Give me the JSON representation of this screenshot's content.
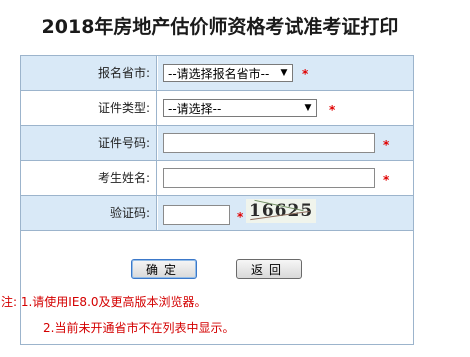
{
  "title": "2018年房地产估价师资格考试准考证打印",
  "form": {
    "province_label": "报名省市:",
    "province_value": "--请选择报名省市--",
    "id_type_label": "证件类型:",
    "id_type_value": "--请选择--",
    "id_number_label": "证件号码:",
    "id_number_value": "",
    "name_label": "考生姓名:",
    "name_value": "",
    "captcha_label": "验证码:",
    "captcha_value": "",
    "captcha_image_text": "16625",
    "required_mark": "*"
  },
  "buttons": {
    "confirm": "确定",
    "back": "返回"
  },
  "notes": {
    "line1": "注: 1.请使用IE8.0及更高版本浏览器。",
    "line2": "2.当前未开通省市不在列表中显示。"
  }
}
